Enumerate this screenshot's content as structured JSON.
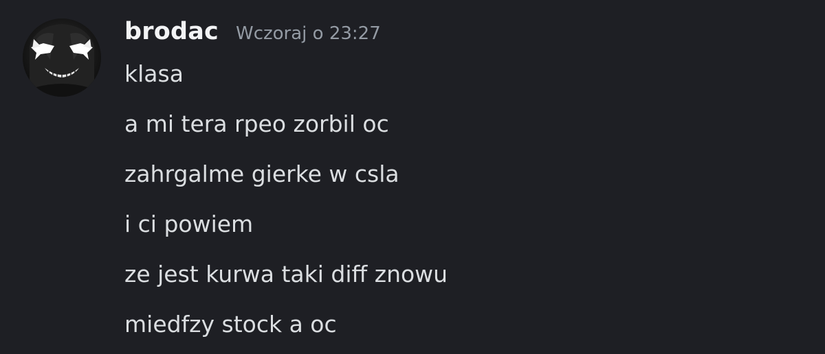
{
  "message": {
    "author": {
      "username": "brodac",
      "avatar_icon": "skull-grin-avatar"
    },
    "timestamp": "Wczoraj o 23:27",
    "lines": [
      "klasa",
      "a mi tera rpeo zorbil oc",
      "zahrgalme gierke w csla",
      "i ci powiem",
      "ze jest kurwa taki diff znowu",
      "miedfzy stock a oc"
    ]
  },
  "colors": {
    "background": "#1e1f24",
    "username": "#f2f3f5",
    "timestamp": "#949ba4",
    "message_text": "#dbdee1"
  }
}
